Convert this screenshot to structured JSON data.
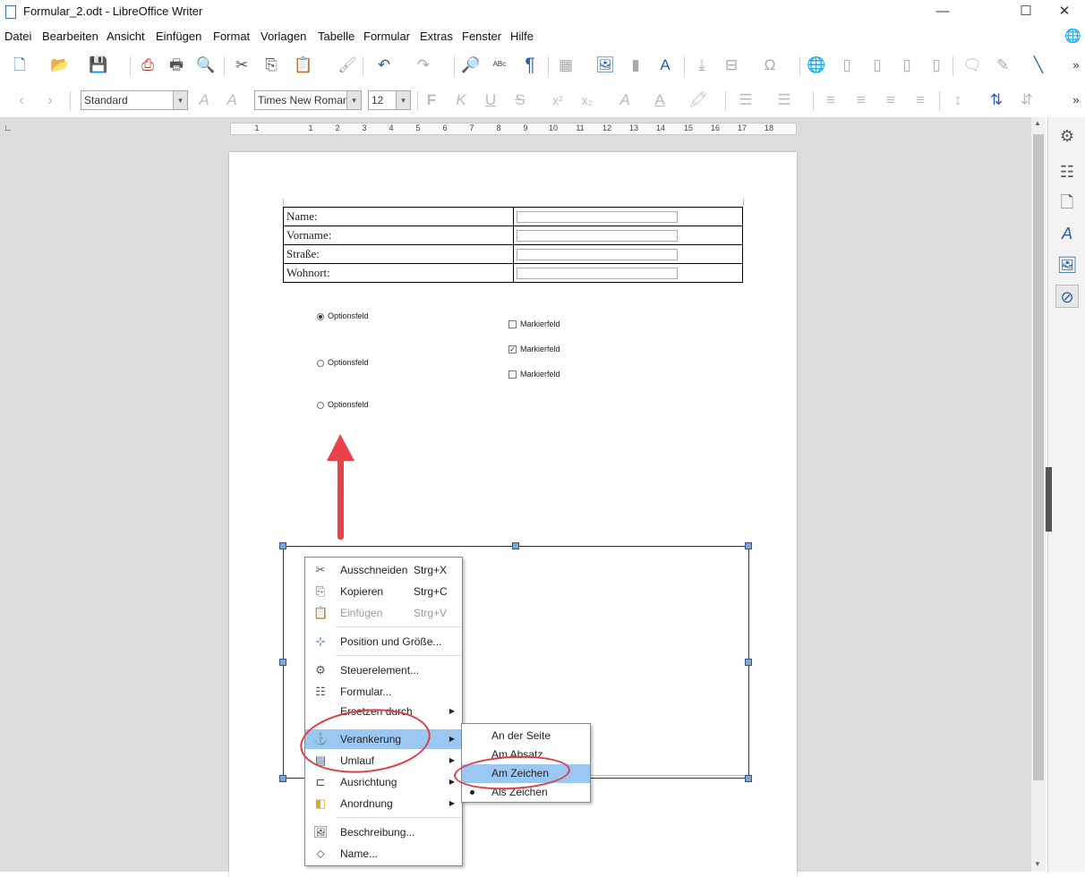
{
  "window": {
    "title": "Formular_2.odt - LibreOffice Writer",
    "btn_minimize": "—",
    "btn_maximize": "☐",
    "btn_close": "✕"
  },
  "menu": [
    "Datei",
    "Bearbeiten",
    "Ansicht",
    "Einfügen",
    "Format",
    "Vorlagen",
    "Tabelle",
    "Formular",
    "Extras",
    "Fenster",
    "Hilfe"
  ],
  "formatting": {
    "paragraph_style": "Standard",
    "font_name": "Times New Roman",
    "font_size": "12",
    "bold": "F",
    "italic": "K",
    "underline": "U",
    "strike": "S"
  },
  "ruler": [
    "1",
    "1",
    "2",
    "3",
    "4",
    "5",
    "6",
    "7",
    "8",
    "9",
    "10",
    "11",
    "12",
    "13",
    "14",
    "15",
    "16",
    "17",
    "18"
  ],
  "table": [
    {
      "label": "Name:"
    },
    {
      "label": "Vorname:"
    },
    {
      "label": "Straße:"
    },
    {
      "label": "Wohnort:"
    }
  ],
  "options": [
    {
      "label": "Optionsfeld",
      "selected": true
    },
    {
      "label": "Optionsfeld",
      "selected": false
    },
    {
      "label": "Optionsfeld",
      "selected": false
    }
  ],
  "checkboxes": [
    {
      "label": "Markierfeld",
      "checked": false
    },
    {
      "label": "Markierfeld",
      "checked": true
    },
    {
      "label": "Markierfeld",
      "checked": false
    }
  ],
  "context_menu": {
    "cut": {
      "label": "Ausschneiden",
      "shortcut": "Strg+X"
    },
    "copy": {
      "label": "Kopieren",
      "shortcut": "Strg+C"
    },
    "paste": {
      "label": "Einfügen",
      "shortcut": "Strg+V"
    },
    "position": {
      "label": "Position und Größe..."
    },
    "control": {
      "label": "Steuerelement..."
    },
    "form": {
      "label": "Formular..."
    },
    "replace": {
      "label": "Ersetzen durch"
    },
    "anchor": {
      "label": "Verankerung"
    },
    "wrap": {
      "label": "Umlauf"
    },
    "align": {
      "label": "Ausrichtung"
    },
    "arrange": {
      "label": "Anordnung"
    },
    "description": {
      "label": "Beschreibung..."
    },
    "name": {
      "label": "Name..."
    }
  },
  "anchor_submenu": {
    "page": "An der Seite",
    "paragraph": "Am Absatz",
    "char": "Am Zeichen",
    "as_char": "Als Zeichen"
  },
  "colors": {
    "highlight": "#9ac8f2",
    "annotation": "#e03c44"
  }
}
